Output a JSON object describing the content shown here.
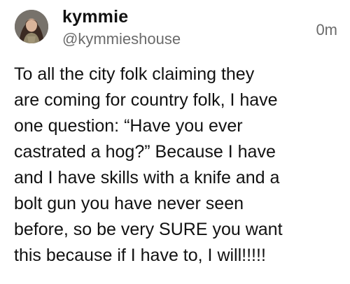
{
  "post": {
    "author": {
      "display_name": "kymmie",
      "handle": "@kymmieshouse",
      "avatar_icon": "user-avatar-photo"
    },
    "timestamp": "0m",
    "body_lines": [
      "To all the city folk claiming they",
      "are coming for country folk, I have",
      "one question: “Have you ever",
      "castrated a hog?” Because I have",
      "and I have skills with a knife and a",
      "bolt gun you have never seen",
      "before, so be very SURE you want",
      "this because if I have to, I will!!!!!"
    ]
  }
}
